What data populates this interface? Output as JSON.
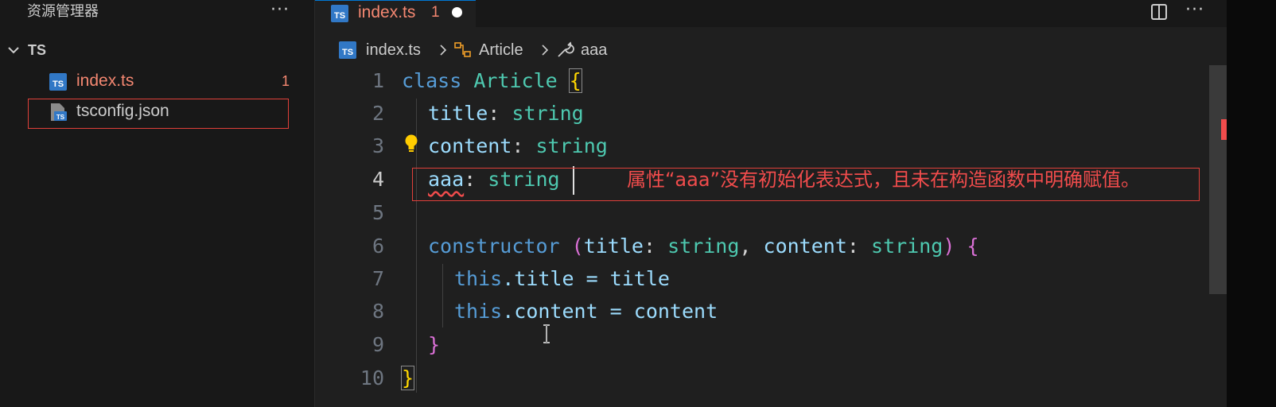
{
  "explorer": {
    "title": "资源管理器",
    "more": "···",
    "folder": "TS",
    "files": [
      {
        "name": "index.ts",
        "badge": "1",
        "status": "error"
      },
      {
        "name": "tsconfig.json",
        "badge": ""
      }
    ],
    "ts_icon_text": "TS"
  },
  "tabs": [
    {
      "label": "index.ts",
      "badge": "1",
      "dirty": true
    }
  ],
  "toolbar": {
    "more": "···"
  },
  "breadcrumb": [
    "index.ts",
    "Article",
    "aaa"
  ],
  "editor": {
    "active_line": 4,
    "line_numbers": [
      "1",
      "2",
      "3",
      "4",
      "5",
      "6",
      "7",
      "8",
      "9",
      "10"
    ],
    "tokens": {
      "l1_class": "class",
      "l1_name": "Article",
      "l1_brace": "{",
      "l2_prop": "title",
      "l2_colon": ":",
      "l2_type": "string",
      "l3_prop": "content",
      "l3_colon": ":",
      "l3_type": "string",
      "l4_prop": "aaa",
      "l4_colon": ":",
      "l4_type": "string",
      "l6_ctor": "constructor",
      "l6_paren_open": "(",
      "l6_p1": "title",
      "l6_c1": ":",
      "l6_t1": "string",
      "l6_comma": ",",
      "l6_p2": "content",
      "l6_c2": ":",
      "l6_t2": "string",
      "l6_paren_close": ")",
      "l6_brace": "{",
      "l7_this": "this",
      "l7_rest": ".title = title",
      "l8_this": "this",
      "l8_rest": ".content = content",
      "l9_brace": "}",
      "l10_brace": "}"
    },
    "error_message": "属性“aaa”没有初始化表达式，且未在构造函数中明确赋值。"
  },
  "colors": {
    "error": "#f14c4c",
    "keyword": "#569cd6",
    "type": "#4ec9b0",
    "property": "#9cdcfe",
    "highlight_box": "#e0403a"
  }
}
